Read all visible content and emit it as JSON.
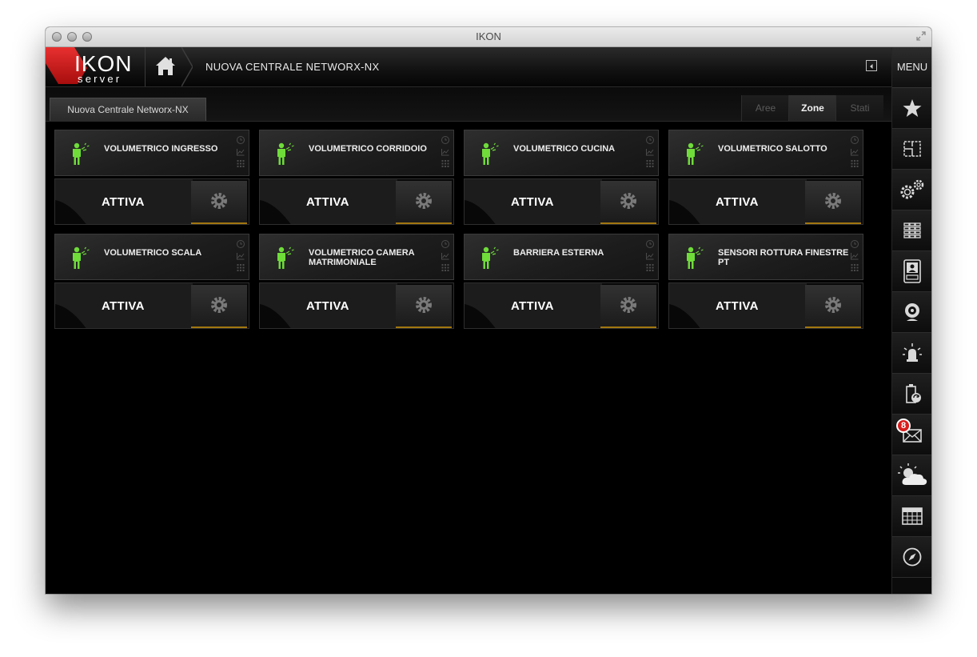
{
  "window": {
    "title": "IKON"
  },
  "logo": {
    "brand_top": "IKON",
    "brand_bottom": "server"
  },
  "header": {
    "title": "NUOVA CENTRALE NETWORX-NX"
  },
  "sidebar": {
    "menu_label": "MENU",
    "items": [
      {
        "icon": "star-icon"
      },
      {
        "icon": "floor-plan-icon"
      },
      {
        "icon": "gears-icon"
      },
      {
        "icon": "keypad-icon"
      },
      {
        "icon": "intercom-icon"
      },
      {
        "icon": "webcam-icon"
      },
      {
        "icon": "alarm-siren-icon"
      },
      {
        "icon": "battery-sync-icon"
      },
      {
        "icon": "mail-icon",
        "badge": "8"
      },
      {
        "icon": "weather-icon"
      },
      {
        "icon": "calendar-icon"
      },
      {
        "icon": "compass-icon"
      }
    ]
  },
  "tabs": {
    "main": "Nuova Centrale Networx-NX",
    "segments": [
      {
        "label": "Aree",
        "active": false
      },
      {
        "label": "Zone",
        "active": true
      },
      {
        "label": "Stati",
        "active": false
      }
    ]
  },
  "zones": [
    {
      "name": "VOLUMETRICO INGRESSO",
      "status": "ATTIVA"
    },
    {
      "name": "VOLUMETRICO CORRIDOIO",
      "status": "ATTIVA"
    },
    {
      "name": "VOLUMETRICO CUCINA",
      "status": "ATTIVA"
    },
    {
      "name": "VOLUMETRICO SALOTTO",
      "status": "ATTIVA"
    },
    {
      "name": "VOLUMETRICO SCALA",
      "status": "ATTIVA"
    },
    {
      "name": "VOLUMETRICO CAMERA MATRIMONIALE",
      "status": "ATTIVA"
    },
    {
      "name": "BARRIERA ESTERNA",
      "status": "ATTIVA"
    },
    {
      "name": "SENSORI ROTTURA FINESTRE PT",
      "status": "ATTIVA"
    }
  ],
  "colors": {
    "accent": "#a27710",
    "sensor_green": "#6fdc3a",
    "badge_red": "#d81e1e"
  }
}
